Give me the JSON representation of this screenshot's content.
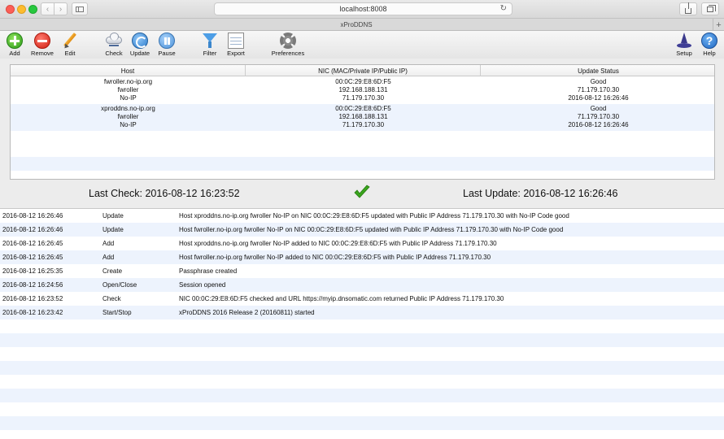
{
  "browser": {
    "url": "localhost:8008",
    "tab_title": "xProDDNS",
    "back_icon": "‹",
    "forward_icon": "›",
    "reload_icon": "↻",
    "plus_icon": "+"
  },
  "toolbar": {
    "add": "Add",
    "remove": "Remove",
    "edit": "Edit",
    "check": "Check",
    "update": "Update",
    "pause": "Pause",
    "filter": "Filter",
    "export": "Export",
    "preferences": "Preferences",
    "setup": "Setup",
    "help": "Help",
    "help_glyph": "?"
  },
  "hosts": {
    "columns": [
      "Host",
      "NIC (MAC/Private IP/Public IP)",
      "Update Status"
    ],
    "rows": [
      {
        "host": [
          "fwroller.no-ip.org",
          "fwroller",
          "No-IP"
        ],
        "nic": [
          "00:0C:29:E8:6D:F5",
          "192.168.188.131",
          "71.179.170.30"
        ],
        "status": [
          "Good",
          "71.179.170.30",
          "2016-08-12 16:26:46"
        ]
      },
      {
        "host": [
          "xproddns.no-ip.org",
          "fwroller",
          "No-IP"
        ],
        "nic": [
          "00:0C:29:E8:6D:F5",
          "192.168.188.131",
          "71.179.170.30"
        ],
        "status": [
          "Good",
          "71.179.170.30",
          "2016-08-12 16:26:46"
        ]
      }
    ]
  },
  "status": {
    "last_check": "Last Check: 2016-08-12 16:23:52",
    "last_update": "Last Update: 2016-08-12 16:26:46",
    "ok_color": "#3aa51d"
  },
  "log": [
    {
      "time": "2016-08-12 16:26:46",
      "type": "Update",
      "message": "Host xproddns.no-ip.org fwroller No-IP on NIC 00:0C:29:E8:6D:F5 updated with Public IP Address 71.179.170.30 with No-IP Code good"
    },
    {
      "time": "2016-08-12 16:26:46",
      "type": "Update",
      "message": "Host fwroller.no-ip.org fwroller No-IP on NIC 00:0C:29:E8:6D:F5 updated with Public IP Address 71.179.170.30 with No-IP Code good"
    },
    {
      "time": "2016-08-12 16:26:45",
      "type": "Add",
      "message": "Host xproddns.no-ip.org fwroller No-IP added to NIC 00:0C:29:E8:6D:F5 with Public IP Address 71.179.170.30"
    },
    {
      "time": "2016-08-12 16:26:45",
      "type": "Add",
      "message": "Host fwroller.no-ip.org fwroller No-IP added to NIC 00:0C:29:E8:6D:F5 with Public IP Address 71.179.170.30"
    },
    {
      "time": "2016-08-12 16:25:35",
      "type": "Create",
      "message": "Passphrase created"
    },
    {
      "time": "2016-08-12 16:24:56",
      "type": "Open/Close",
      "message": "Session opened"
    },
    {
      "time": "2016-08-12 16:23:52",
      "type": "Check",
      "message": "NIC 00:0C:29:E8:6D:F5 checked and URL https://myip.dnsomatic.com returned Public IP Address 71.179.170.30"
    },
    {
      "time": "2016-08-12 16:23:42",
      "type": "Start/Stop",
      "message": "xProDDNS 2016 Release 2 (20160811) started"
    }
  ]
}
